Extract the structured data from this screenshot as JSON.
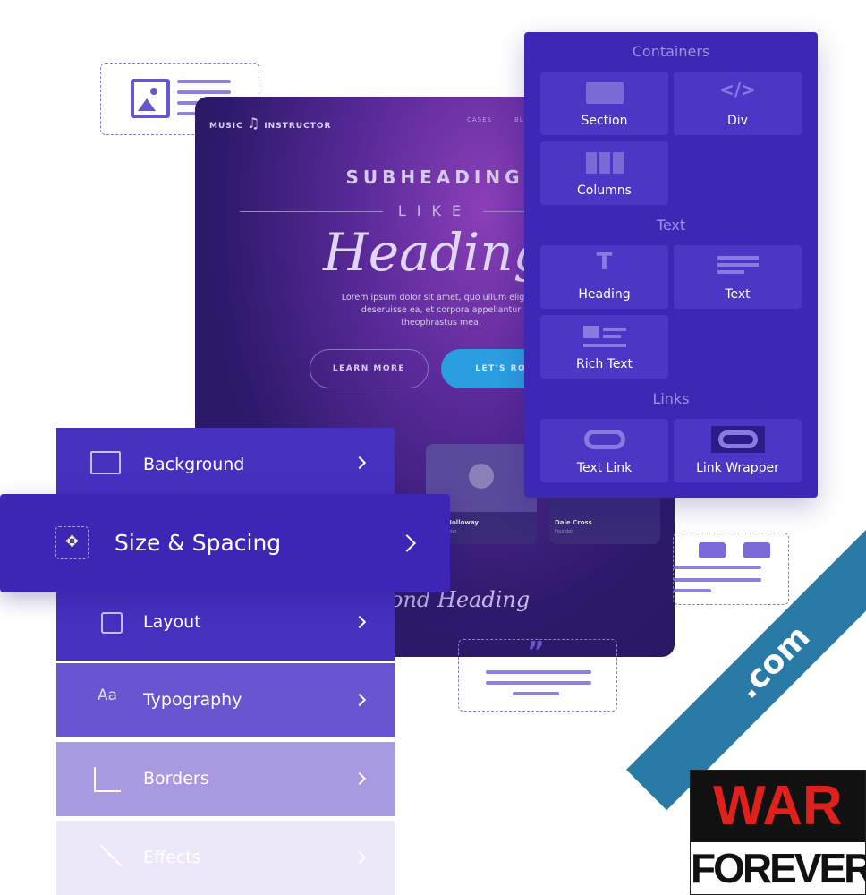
{
  "preview": {
    "brand_left": "MUSIC",
    "brand_right": "INSTRUCTOR",
    "nav": [
      "CASES",
      "BLO"
    ],
    "subheading": "SUBHEADING",
    "like": "LIKE",
    "heading": "Heading",
    "lorem_1": "Lorem ipsum dolor sit amet, quo ullum eligend",
    "lorem_2": "deseruisse ea, et corpora appellantur",
    "lorem_3": "theophrastus mea.",
    "learn_more": "LEARN MORE",
    "lets_rock": "LET'S ROCK",
    "cards": [
      {
        "name": "nna Holloway",
        "sub": "Co-Founder"
      },
      {
        "name": "Dale Cross",
        "sub": "Founder"
      }
    ],
    "second_heading": "ond Heading"
  },
  "panel": {
    "sections": [
      {
        "title": "Containers",
        "items": [
          {
            "label": "Section",
            "icon": "section-icon"
          },
          {
            "label": "Div",
            "icon": "code-icon"
          },
          {
            "label": "Columns",
            "icon": "columns-icon"
          }
        ]
      },
      {
        "title": "Text",
        "items": [
          {
            "label": "Heading",
            "icon": "heading-icon"
          },
          {
            "label": "Text",
            "icon": "text-icon"
          },
          {
            "label": "Rich Text",
            "icon": "rich-text-icon"
          }
        ]
      },
      {
        "title": "Links",
        "items": [
          {
            "label": "Text Link",
            "icon": "link-icon"
          },
          {
            "label": "Link Wrapper",
            "icon": "link-wrapper-icon"
          }
        ]
      }
    ]
  },
  "style_menu": [
    {
      "label": "Background",
      "icon": "image-icon"
    },
    {
      "label": "Size & Spacing",
      "icon": "move-icon"
    },
    {
      "label": "Layout",
      "icon": "layout-icon"
    },
    {
      "label": "Typography",
      "icon": "typography-icon"
    },
    {
      "label": "Borders",
      "icon": "borders-icon"
    },
    {
      "label": "Effects",
      "icon": "effects-icon"
    }
  ],
  "watermark": {
    "line1": "WAR",
    "line2": "FOREVER",
    "ribbon": ".com"
  },
  "colors": {
    "panel": "#3c28b4",
    "accent": "#8f7fe0",
    "button": "#2a9ee0"
  }
}
